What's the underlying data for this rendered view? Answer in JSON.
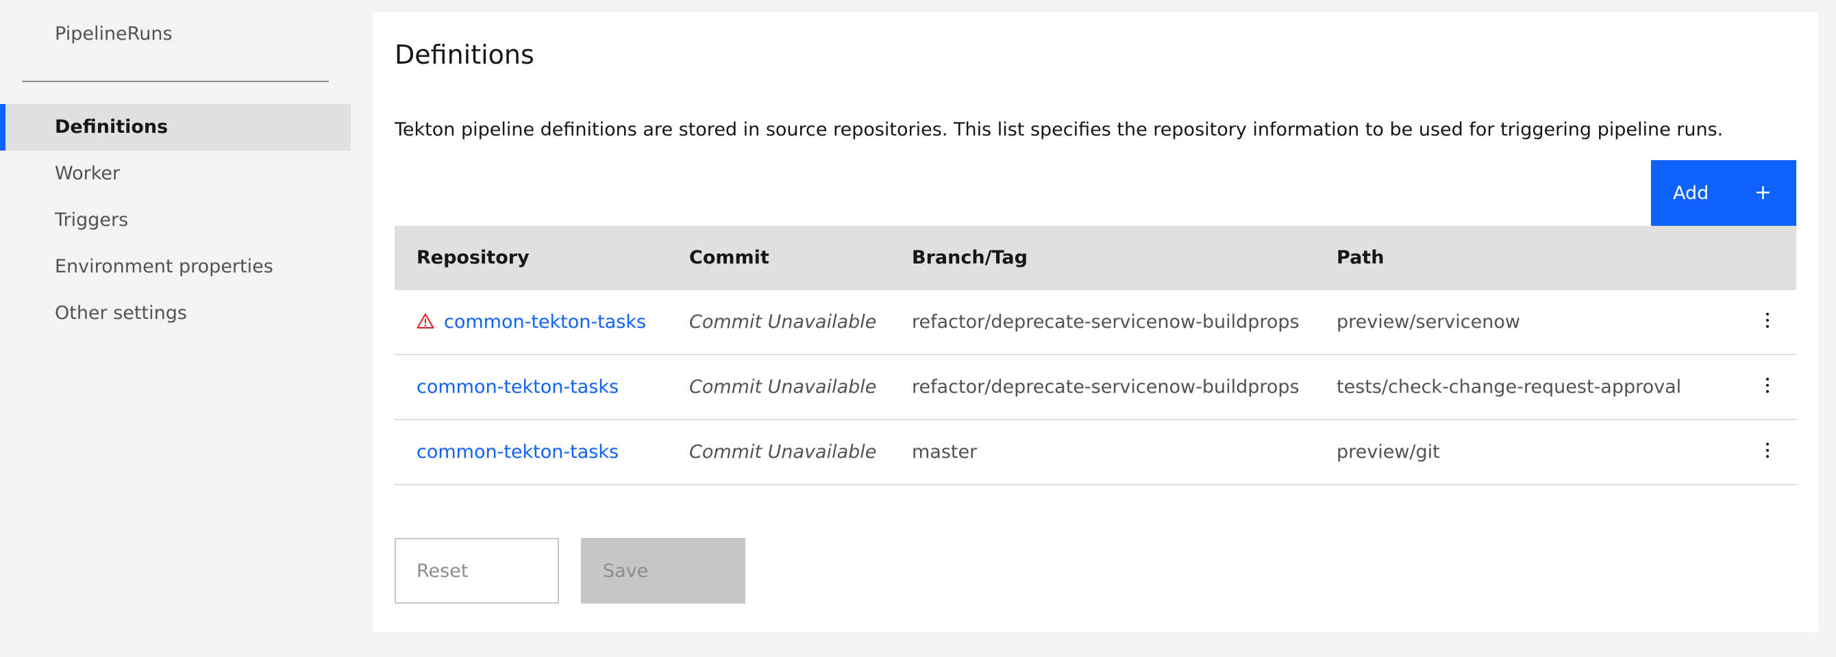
{
  "sidebar": {
    "top_link": "PipelineRuns",
    "items": [
      {
        "label": "Definitions"
      },
      {
        "label": "Worker"
      },
      {
        "label": "Triggers"
      },
      {
        "label": "Environment properties"
      },
      {
        "label": "Other settings"
      }
    ],
    "active_index": 0
  },
  "main": {
    "title": "Definitions",
    "description": "Tekton pipeline definitions are stored in source repositories. This list specifies the repository information to be used for triggering pipeline runs.",
    "add_label": "Add",
    "add_icon": "+",
    "table": {
      "headers": [
        "Repository",
        "Commit",
        "Branch/Tag",
        "Path"
      ],
      "rows": [
        {
          "repository": "common-tekton-tasks",
          "commit": "Commit Unavailable",
          "branch": "refactor/deprecate-servicenow-buildprops",
          "path": "preview/servicenow",
          "warning": true
        },
        {
          "repository": "common-tekton-tasks",
          "commit": "Commit Unavailable",
          "branch": "refactor/deprecate-servicenow-buildprops",
          "path": "tests/check-change-request-approval",
          "warning": false
        },
        {
          "repository": "common-tekton-tasks",
          "commit": "Commit Unavailable",
          "branch": "master",
          "path": "preview/git",
          "warning": false
        }
      ]
    },
    "reset_label": "Reset",
    "save_label": "Save"
  },
  "colors": {
    "accent": "#0f62fe",
    "warning": "#da1e28",
    "background": "#f3f3f3",
    "header_bg": "#e0e0e0"
  },
  "icons": {
    "warning": "warning-triangle-icon",
    "overflow": "overflow-menu-vertical-icon",
    "add": "add-icon"
  }
}
